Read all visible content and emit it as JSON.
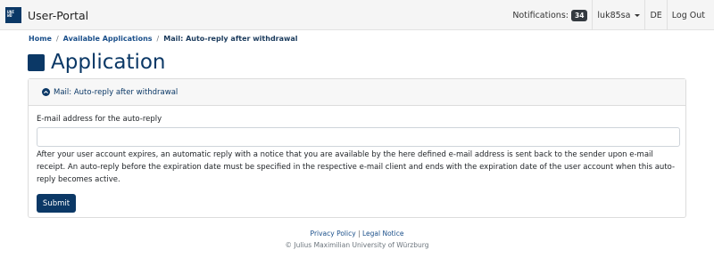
{
  "navbar": {
    "logo_lines": [
      "UNI",
      "WÜ"
    ],
    "brand": "User-Portal",
    "notifications_label": "Notifications:",
    "notifications_count": "34",
    "user": "luk85sa",
    "language": "DE",
    "logout": "Log Out"
  },
  "breadcrumb": {
    "home": "Home",
    "separator": "/",
    "apps": "Available Applications",
    "current": "Mail: Auto-reply after withdrawal"
  },
  "page": {
    "title": "Application"
  },
  "panel": {
    "title": "Mail: Auto-reply after withdrawal",
    "field_label": "E-mail address for the auto-reply",
    "field_value": "",
    "help_text": "After your user account expires, an automatic reply with a notice that you are available by the here defined e-mail address is sent back to the sender upon e-mail receipt. An auto-reply before the expiration date must be specified in the respective e-mail client and ends with the expiration date of the user account when this auto-reply becomes active.",
    "submit": "Submit"
  },
  "footer": {
    "privacy": "Privacy Policy",
    "pipe": "|",
    "legal": "Legal Notice",
    "copyright": "© Julius Maximilian University of Würzburg"
  },
  "colors": {
    "primary": "#0b3866",
    "link": "#1a4f8a",
    "navbar_bg": "#f5f5f5"
  }
}
